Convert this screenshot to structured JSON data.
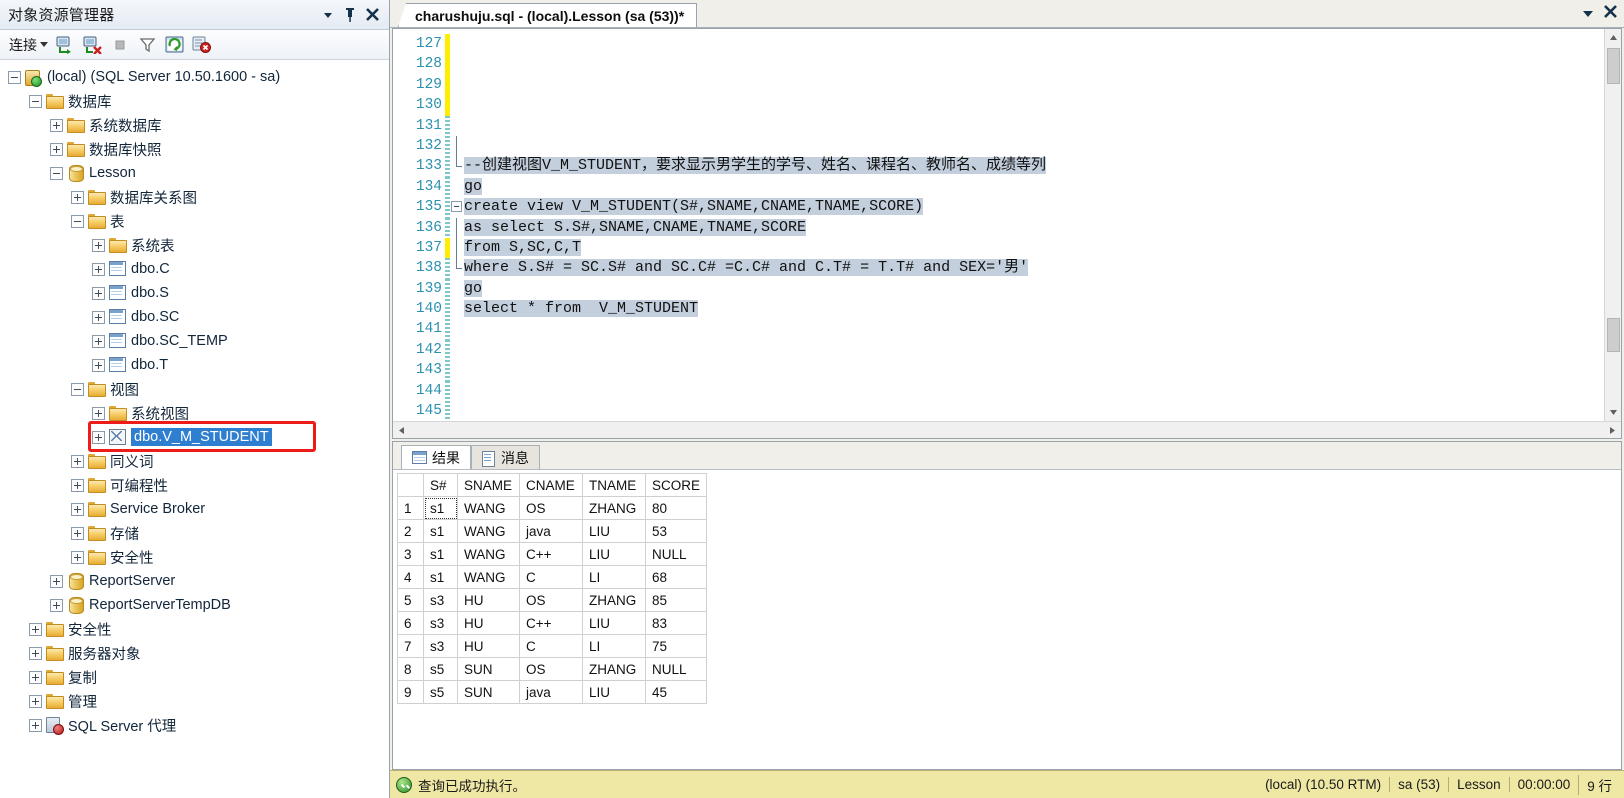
{
  "object_explorer": {
    "title": "对象资源管理器",
    "titlebar_buttons": [
      {
        "name": "dropdown-icon",
        "glyph": "▼"
      },
      {
        "name": "pin-icon",
        "glyph": "⊥"
      },
      {
        "name": "close-icon",
        "glyph": "✕"
      }
    ],
    "toolbar": {
      "connect_label": "连接",
      "icons": [
        "connect-object-explorer-icon",
        "disconnect-object-explorer-icon",
        "stop-icon",
        "filter-icon",
        "refresh-icon",
        "sql-agent-status-icon"
      ]
    },
    "tree": [
      {
        "label": "(local) (SQL Server 10.50.1600 - sa)",
        "indent": 0,
        "expander": "minus",
        "icon": "server-icon"
      },
      {
        "label": "数据库",
        "indent": 1,
        "expander": "minus",
        "icon": "folder-icon"
      },
      {
        "label": "系统数据库",
        "indent": 2,
        "expander": "plus",
        "icon": "folder-icon"
      },
      {
        "label": "数据库快照",
        "indent": 2,
        "expander": "plus",
        "icon": "folder-icon"
      },
      {
        "label": "Lesson",
        "indent": 2,
        "expander": "minus",
        "icon": "database-icon"
      },
      {
        "label": "数据库关系图",
        "indent": 3,
        "expander": "plus",
        "icon": "folder-icon"
      },
      {
        "label": "表",
        "indent": 3,
        "expander": "minus",
        "icon": "folder-icon"
      },
      {
        "label": "系统表",
        "indent": 4,
        "expander": "plus",
        "icon": "folder-icon"
      },
      {
        "label": "dbo.C",
        "indent": 4,
        "expander": "plus",
        "icon": "table-icon"
      },
      {
        "label": "dbo.S",
        "indent": 4,
        "expander": "plus",
        "icon": "table-icon"
      },
      {
        "label": "dbo.SC",
        "indent": 4,
        "expander": "plus",
        "icon": "table-icon"
      },
      {
        "label": "dbo.SC_TEMP",
        "indent": 4,
        "expander": "plus",
        "icon": "table-icon"
      },
      {
        "label": "dbo.T",
        "indent": 4,
        "expander": "plus",
        "icon": "table-icon"
      },
      {
        "label": "视图",
        "indent": 3,
        "expander": "minus",
        "icon": "folder-icon"
      },
      {
        "label": "系统视图",
        "indent": 4,
        "expander": "plus",
        "icon": "folder-icon"
      },
      {
        "label": "dbo.V_M_STUDENT",
        "indent": 4,
        "expander": "plus",
        "icon": "view-icon",
        "selected": true,
        "highlighted": true
      },
      {
        "label": "同义词",
        "indent": 3,
        "expander": "plus",
        "icon": "folder-icon"
      },
      {
        "label": "可编程性",
        "indent": 3,
        "expander": "plus",
        "icon": "folder-icon"
      },
      {
        "label": "Service Broker",
        "indent": 3,
        "expander": "plus",
        "icon": "folder-icon"
      },
      {
        "label": "存储",
        "indent": 3,
        "expander": "plus",
        "icon": "folder-icon"
      },
      {
        "label": "安全性",
        "indent": 3,
        "expander": "plus",
        "icon": "folder-icon"
      },
      {
        "label": "ReportServer",
        "indent": 2,
        "expander": "plus",
        "icon": "database-icon"
      },
      {
        "label": "ReportServerTempDB",
        "indent": 2,
        "expander": "plus",
        "icon": "database-icon"
      },
      {
        "label": "安全性",
        "indent": 1,
        "expander": "plus",
        "icon": "folder-icon"
      },
      {
        "label": "服务器对象",
        "indent": 1,
        "expander": "plus",
        "icon": "folder-icon"
      },
      {
        "label": "复制",
        "indent": 1,
        "expander": "plus",
        "icon": "folder-icon"
      },
      {
        "label": "管理",
        "indent": 1,
        "expander": "plus",
        "icon": "folder-icon"
      },
      {
        "label": "SQL Server 代理",
        "indent": 1,
        "expander": "plus",
        "icon": "sql-agent-icon"
      }
    ],
    "selection_highlight_color": "#ee1c19"
  },
  "editor": {
    "tab_title": "charushuju.sql - (local).Lesson (sa (53))*",
    "tabstrip_buttons": [
      {
        "name": "tab-list-dropdown-icon",
        "glyph": "▼"
      },
      {
        "name": "close-tab-icon",
        "glyph": "✕"
      }
    ],
    "first_line_number": 127,
    "lines": [
      {
        "n": 127,
        "text": "",
        "sel": false,
        "change": "yellow",
        "fold": ""
      },
      {
        "n": 128,
        "text": "",
        "sel": false,
        "change": "yellow",
        "fold": ""
      },
      {
        "n": 129,
        "text": "",
        "sel": false,
        "change": "yellow",
        "fold": ""
      },
      {
        "n": 130,
        "text": "",
        "sel": false,
        "change": "yellow",
        "fold": ""
      },
      {
        "n": 131,
        "text": "",
        "sel": false,
        "change": "dot",
        "fold": ""
      },
      {
        "n": 132,
        "text": "",
        "sel": false,
        "change": "dot",
        "fold": "bar"
      },
      {
        "n": 133,
        "text": "--创建视图V_M_STUDENT，要求显示男学生的学号、姓名、课程名、教师名、成绩等列",
        "sel": true,
        "change": "dot",
        "fold": "end"
      },
      {
        "n": 134,
        "text": "go",
        "sel": true,
        "change": "dot",
        "fold": ""
      },
      {
        "n": 135,
        "text": "create view V_M_STUDENT(S#,SNAME,CNAME,TNAME,SCORE)",
        "sel": true,
        "change": "dot",
        "fold": "minus"
      },
      {
        "n": 136,
        "text": "as select S.S#,SNAME,CNAME,TNAME,SCORE",
        "sel": true,
        "change": "dot",
        "fold": "bar"
      },
      {
        "n": 137,
        "text": "from S,SC,C,T",
        "sel": true,
        "change": "yellow",
        "fold": "bar"
      },
      {
        "n": 138,
        "text": "where S.S# = SC.S# and SC.C# =C.C# and C.T# = T.T# and SEX='男'",
        "sel": true,
        "change": "dot",
        "fold": "end"
      },
      {
        "n": 139,
        "text": "go",
        "sel": true,
        "change": "dot",
        "fold": ""
      },
      {
        "n": 140,
        "text": "select * from  V_M_STUDENT",
        "sel": true,
        "change": "dot",
        "fold": ""
      },
      {
        "n": 141,
        "text": "",
        "sel": false,
        "change": "dot",
        "fold": ""
      },
      {
        "n": 142,
        "text": "",
        "sel": false,
        "change": "dot",
        "fold": ""
      },
      {
        "n": 143,
        "text": "",
        "sel": false,
        "change": "dot",
        "fold": ""
      },
      {
        "n": 144,
        "text": "",
        "sel": false,
        "change": "dot",
        "fold": ""
      },
      {
        "n": 145,
        "text": "",
        "sel": false,
        "change": "dot",
        "fold": ""
      }
    ],
    "scrollbars": {
      "up_arrow": "▲",
      "down_arrow": "▼",
      "left_arrow": "◄",
      "right_arrow": "►"
    }
  },
  "results": {
    "tabs": [
      {
        "label": "结果",
        "icon": "grid-icon",
        "active": true
      },
      {
        "label": "消息",
        "icon": "message-icon",
        "active": false
      }
    ],
    "columns": [
      "",
      "S#",
      "SNAME",
      "CNAME",
      "TNAME",
      "SCORE"
    ],
    "rows": [
      {
        "n": "1",
        "S#": "s1",
        "SNAME": "WANG",
        "CNAME": "OS",
        "TNAME": "ZHANG",
        "SCORE": "80"
      },
      {
        "n": "2",
        "S#": "s1",
        "SNAME": "WANG",
        "CNAME": "java",
        "TNAME": "LIU",
        "SCORE": "53"
      },
      {
        "n": "3",
        "S#": "s1",
        "SNAME": "WANG",
        "CNAME": "C++",
        "TNAME": "LIU",
        "SCORE": "NULL"
      },
      {
        "n": "4",
        "S#": "s1",
        "SNAME": "WANG",
        "CNAME": "C",
        "TNAME": "LI",
        "SCORE": "68"
      },
      {
        "n": "5",
        "S#": "s3",
        "SNAME": "HU",
        "CNAME": "OS",
        "TNAME": "ZHANG",
        "SCORE": "85"
      },
      {
        "n": "6",
        "S#": "s3",
        "SNAME": "HU",
        "CNAME": "C++",
        "TNAME": "LIU",
        "SCORE": "83"
      },
      {
        "n": "7",
        "S#": "s3",
        "SNAME": "HU",
        "CNAME": "C",
        "TNAME": "LI",
        "SCORE": "75"
      },
      {
        "n": "8",
        "S#": "s5",
        "SNAME": "SUN",
        "CNAME": "OS",
        "TNAME": "ZHANG",
        "SCORE": "NULL"
      },
      {
        "n": "9",
        "S#": "s5",
        "SNAME": "SUN",
        "CNAME": "java",
        "TNAME": "LIU",
        "SCORE": "45"
      }
    ],
    "null_text": "NULL",
    "focused_cell": {
      "row": 0,
      "column": "S#"
    }
  },
  "statusbar": {
    "status_icon": "success-check-icon",
    "message": "查询已成功执行。",
    "items": [
      "(local) (10.50 RTM)",
      "sa (53)",
      "Lesson",
      "00:00:00",
      "9 行"
    ],
    "background": "#efe8a5"
  }
}
